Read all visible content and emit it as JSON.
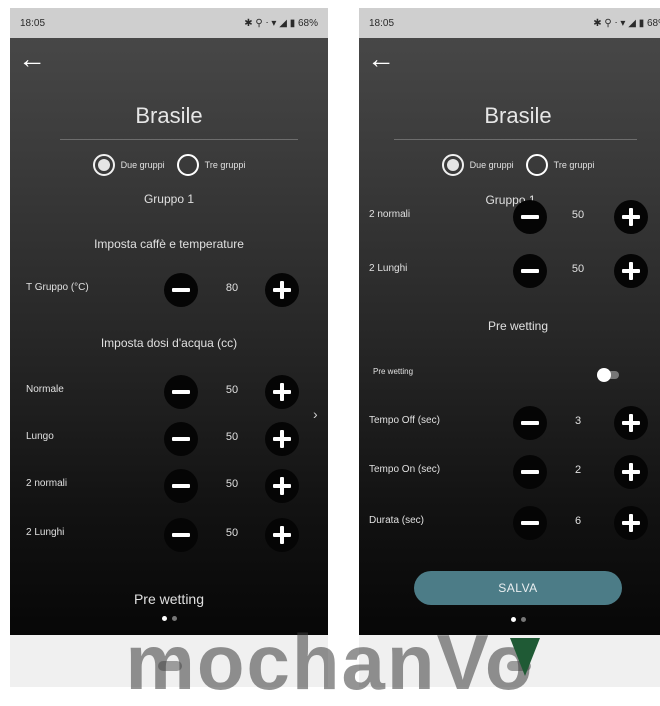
{
  "screens": [
    {
      "status": {
        "time": "18:05",
        "icons": "✱ ⚲ ⋅ ▾ ◢ ▮ 68%"
      },
      "title": "Brasile",
      "radio_options": [
        {
          "label": "Due gruppi",
          "selected": true
        },
        {
          "label": "Tre gruppi",
          "selected": false
        }
      ],
      "group_label": "Gruppo 1",
      "section_temp": "Imposta caffè e temperature",
      "temp_row": {
        "label": "T Gruppo (°C)",
        "value": "80"
      },
      "section_doses": "Imposta dosi d'acqua (cc)",
      "dose_rows": [
        {
          "label": "Normale",
          "value": "50"
        },
        {
          "label": "Lungo",
          "value": "50"
        },
        {
          "label": "2 normali",
          "value": "50"
        },
        {
          "label": "2 Lunghi",
          "value": "50"
        }
      ],
      "section_prewetting": "Pre wetting",
      "next_arrow": "›"
    },
    {
      "status": {
        "time": "18:05",
        "icons": "✱ ⚲ ⋅ ▾ ◢ ▮ 68%"
      },
      "title": "Brasile",
      "radio_options": [
        {
          "label": "Due gruppi",
          "selected": true
        },
        {
          "label": "Tre gruppi",
          "selected": false
        }
      ],
      "group_label": "Gruppo 1",
      "dose_rows": [
        {
          "label": "2 normali",
          "value": "50"
        },
        {
          "label": "2 Lunghi",
          "value": "50"
        }
      ],
      "section_prewetting": "Pre wetting",
      "prewetting_toggle": {
        "label": "Pre wetting",
        "on": false
      },
      "timing_rows": [
        {
          "label": "Tempo Off (sec)",
          "value": "3"
        },
        {
          "label": "Tempo On (sec)",
          "value": "2"
        },
        {
          "label": "Durata (sec)",
          "value": "6"
        }
      ],
      "save_label": "SALVA"
    }
  ],
  "watermark": "mochanVo",
  "colors": {
    "save_button": "#4c7c87",
    "watermark_accent": "#1f5a35"
  },
  "icons": {
    "back": "arrow-left-icon",
    "minus": "minus-circle-icon",
    "plus": "plus-circle-icon"
  }
}
